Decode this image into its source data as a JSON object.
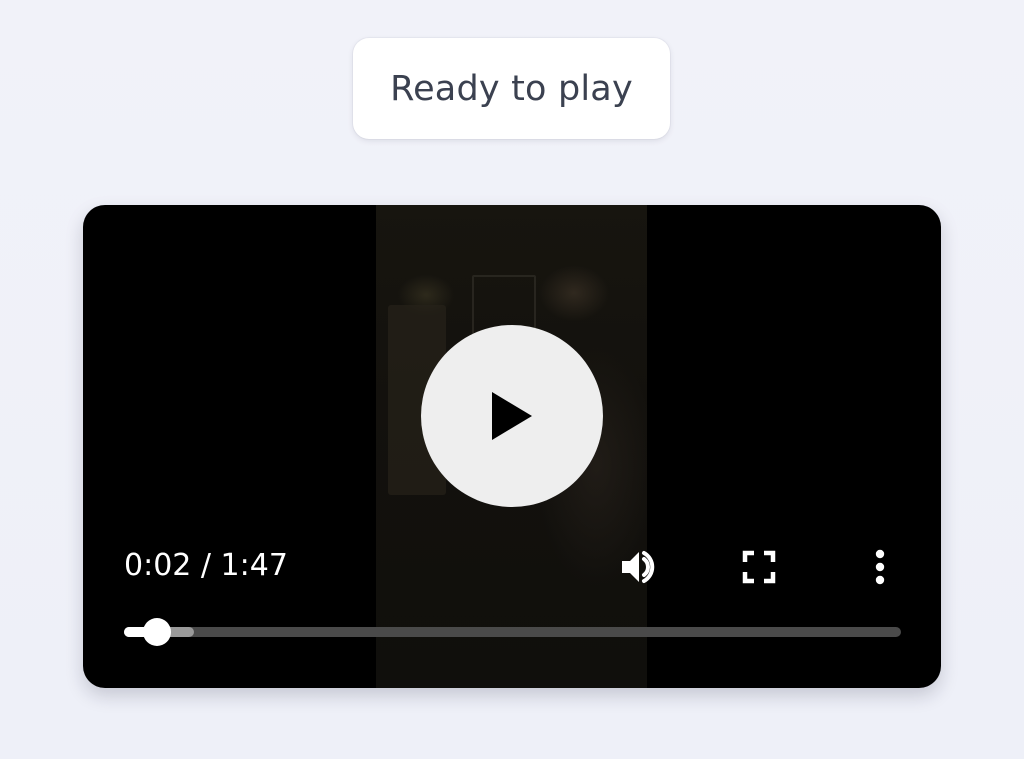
{
  "status": {
    "text": "Ready to play"
  },
  "player": {
    "time_display": "0:02 / 1:47",
    "current_time": "0:02",
    "duration": "1:47",
    "played_fraction": 0.043,
    "buffered_fraction": 0.09,
    "controls": {
      "big_play_icon": "play-icon",
      "volume_icon": "volume-icon",
      "fullscreen_icon": "fullscreen-icon",
      "more_icon": "more-vertical-icon"
    },
    "colors": {
      "background": "#000000",
      "play_button": "#eeeeee",
      "progress_track": "#4a4a4a",
      "progress_buffer": "#9a9a9a",
      "progress_played": "#ffffff"
    }
  }
}
